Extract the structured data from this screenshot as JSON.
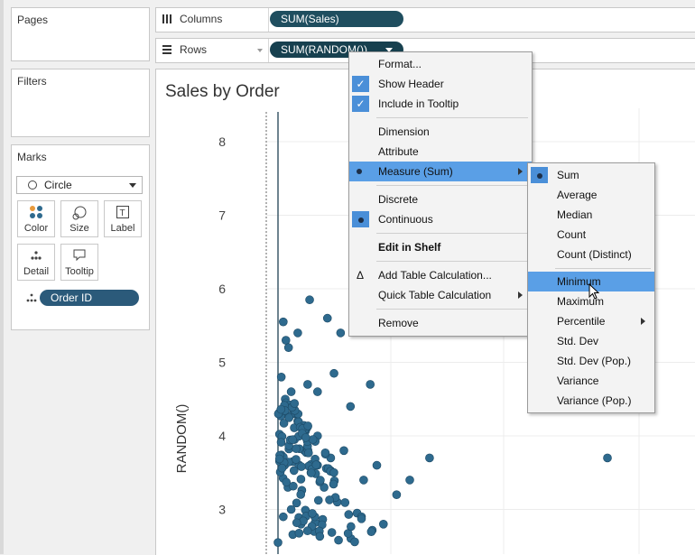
{
  "side": {
    "pages_title": "Pages",
    "filters_title": "Filters",
    "marks_title": "Marks",
    "mark_type": "Circle",
    "buttons": [
      {
        "label": "Color"
      },
      {
        "label": "Size"
      },
      {
        "label": "Label"
      },
      {
        "label": "Detail"
      },
      {
        "label": "Tooltip"
      }
    ],
    "detail_pill": "Order ID"
  },
  "shelves": {
    "columns_label": "Columns",
    "columns_pill": "SUM(Sales)",
    "rows_label": "Rows",
    "rows_pill": "SUM(RANDOM())"
  },
  "view": {
    "title": "Sales by Order"
  },
  "colors": {
    "pill": "#1f4e5f",
    "mark": "#2e6a8e",
    "highlight": "#5a9fe6"
  },
  "menu": {
    "items": [
      "Format...",
      "Show Header",
      "Include in Tooltip",
      "Dimension",
      "Attribute",
      "Measure (Sum)",
      "Discrete",
      "Continuous",
      "Edit in Shelf",
      "Add Table Calculation...",
      "Quick Table Calculation",
      "Remove"
    ],
    "checked": [
      "Show Header",
      "Include in Tooltip"
    ],
    "selected_radio": [
      "Measure (Sum)",
      "Continuous"
    ],
    "highlighted": "Measure (Sum)"
  },
  "submenu": {
    "items": [
      "Sum",
      "Average",
      "Median",
      "Count",
      "Count (Distinct)",
      "Minimum",
      "Maximum",
      "Percentile",
      "Std. Dev",
      "Std. Dev (Pop.)",
      "Variance",
      "Variance (Pop.)"
    ],
    "selected": "Sum",
    "hovered": "Minimum"
  },
  "chart_data": {
    "type": "scatter",
    "title": "Sales by Order",
    "xlabel": "",
    "ylabel": "RANDOM()",
    "ylim": [
      2.55,
      8.4
    ],
    "y_ticks": [
      8,
      7,
      6,
      5,
      4,
      3
    ],
    "grid": true,
    "points": [
      [
        0.008,
        5.55
      ],
      [
        0.012,
        5.3
      ],
      [
        0.005,
        4.8
      ],
      [
        0.011,
        4.5
      ],
      [
        0.02,
        4.6
      ],
      [
        0.016,
        5.2
      ],
      [
        0.03,
        5.4
      ],
      [
        0.048,
        5.85
      ],
      [
        0.075,
        5.6
      ],
      [
        0.095,
        5.4
      ],
      [
        0.11,
        4.4
      ],
      [
        0.23,
        3.7
      ],
      [
        0.5,
        3.7
      ],
      [
        0.06,
        4.6
      ],
      [
        0.045,
        4.7
      ],
      [
        0.085,
        4.85
      ],
      [
        0.14,
        4.7
      ],
      [
        0.02,
        4.4
      ],
      [
        0.03,
        4.2
      ],
      [
        0.06,
        4.0
      ],
      [
        0.1,
        3.8
      ],
      [
        0.15,
        3.6
      ],
      [
        0.18,
        3.2
      ],
      [
        0.2,
        3.4
      ],
      [
        0.025,
        3.95
      ],
      [
        0.04,
        3.8
      ],
      [
        0.05,
        3.5
      ],
      [
        0.07,
        3.3
      ],
      [
        0.09,
        3.1
      ],
      [
        0.12,
        2.95
      ],
      [
        0.16,
        2.8
      ],
      [
        0.01,
        3.6
      ],
      [
        0.015,
        3.3
      ],
      [
        0.02,
        3.0
      ],
      [
        0.035,
        2.8
      ],
      [
        0.055,
        2.7
      ],
      [
        0.008,
        2.9
      ],
      [
        0.06,
        3.6
      ],
      [
        0.08,
        3.7
      ],
      [
        0.13,
        3.4
      ]
    ]
  }
}
